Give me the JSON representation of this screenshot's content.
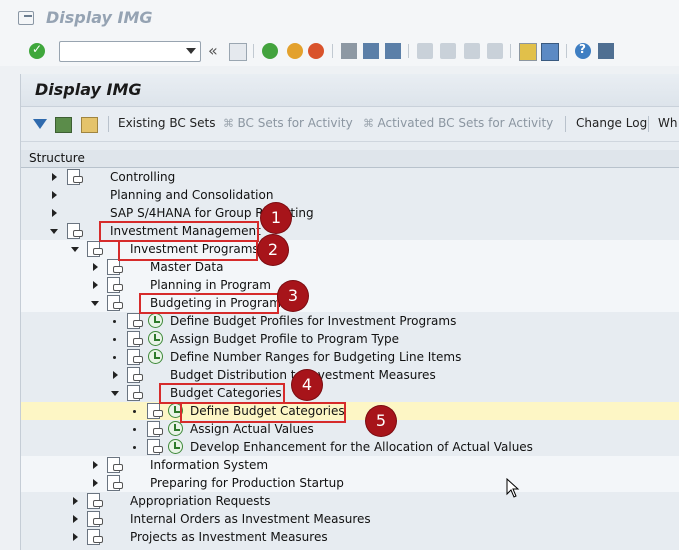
{
  "window": {
    "title": "Display IMG"
  },
  "toolbar": {
    "command_value": "",
    "back_label": "«"
  },
  "panel": {
    "title": "Display IMG",
    "actions": {
      "existing_bc_sets": "Existing BC Sets",
      "bc_sets_for_activity": "BC Sets for Activity",
      "activated_bc_sets": "Activated BC Sets for Activity",
      "change_log": "Change Log",
      "where": "Wh"
    }
  },
  "tree": {
    "header": "Structure",
    "rows": [
      {
        "label": "Controlling"
      },
      {
        "label": "Planning and Consolidation"
      },
      {
        "label": "SAP S/4HANA for Group Reporting"
      },
      {
        "label": "Investment Management"
      },
      {
        "label": "Investment Programs"
      },
      {
        "label": "Master Data"
      },
      {
        "label": "Planning in Program"
      },
      {
        "label": "Budgeting in Program"
      },
      {
        "label": "Define Budget Profiles for Investment Programs"
      },
      {
        "label": "Assign Budget Profile to Program Type"
      },
      {
        "label": "Define Number Ranges for Budgeting Line Items"
      },
      {
        "label": "Budget Distribution to Investment Measures"
      },
      {
        "label": "Budget Categories"
      },
      {
        "label": "Define Budget Categories"
      },
      {
        "label": "Assign Actual Values"
      },
      {
        "label": "Develop Enhancement for the Allocation of Actual Values"
      },
      {
        "label": "Information System"
      },
      {
        "label": "Preparing for Production Startup"
      },
      {
        "label": "Appropriation Requests"
      },
      {
        "label": "Internal Orders as Investment Measures"
      },
      {
        "label": "Projects as Investment Measures"
      }
    ]
  },
  "callouts": [
    "1",
    "2",
    "3",
    "4",
    "5"
  ],
  "colors": {
    "highlight": "#fdf6c5",
    "callout": "#a7141a",
    "box": "#d62b2b"
  }
}
